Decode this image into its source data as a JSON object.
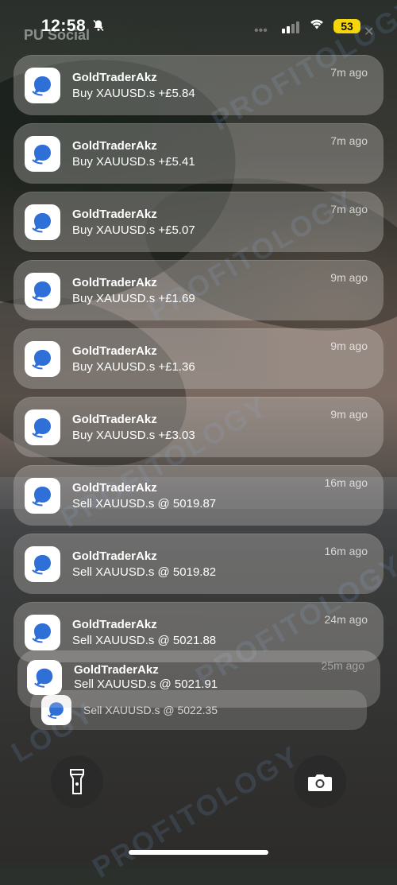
{
  "status": {
    "time": "12:58",
    "battery": "53",
    "carrier_bg": "PU Social"
  },
  "notifications": [
    {
      "app": "GoldTraderAkz",
      "message": "Buy XAUUSD.s +£5.84",
      "ago": "7m ago"
    },
    {
      "app": "GoldTraderAkz",
      "message": "Buy XAUUSD.s +£5.41",
      "ago": "7m ago"
    },
    {
      "app": "GoldTraderAkz",
      "message": "Buy XAUUSD.s +£5.07",
      "ago": "7m ago"
    },
    {
      "app": "GoldTraderAkz",
      "message": "Buy XAUUSD.s +£1.69",
      "ago": "9m ago"
    },
    {
      "app": "GoldTraderAkz",
      "message": "Buy XAUUSD.s +£1.36",
      "ago": "9m ago"
    },
    {
      "app": "GoldTraderAkz",
      "message": "Buy XAUUSD.s +£3.03",
      "ago": "9m ago"
    },
    {
      "app": "GoldTraderAkz",
      "message": "Sell XAUUSD.s @ 5019.87",
      "ago": "16m ago"
    },
    {
      "app": "GoldTraderAkz",
      "message": "Sell XAUUSD.s @ 5019.82",
      "ago": "16m ago"
    },
    {
      "app": "GoldTraderAkz",
      "message": "Sell XAUUSD.s @ 5021.88",
      "ago": "24m ago"
    }
  ],
  "stacked": [
    {
      "app": "GoldTraderAkz",
      "message": "Sell XAUUSD.s @ 5021.91",
      "ago": "25m ago"
    },
    {
      "message": "Sell XAUUSD.s @ 5022.35"
    }
  ],
  "watermark": "PROFITOLOGY",
  "icons": {
    "app": "chat-bubble-icon",
    "flashlight": "flashlight-icon",
    "camera": "camera-icon",
    "dnd": "bell-slash-icon",
    "wifi": "wifi-icon"
  }
}
